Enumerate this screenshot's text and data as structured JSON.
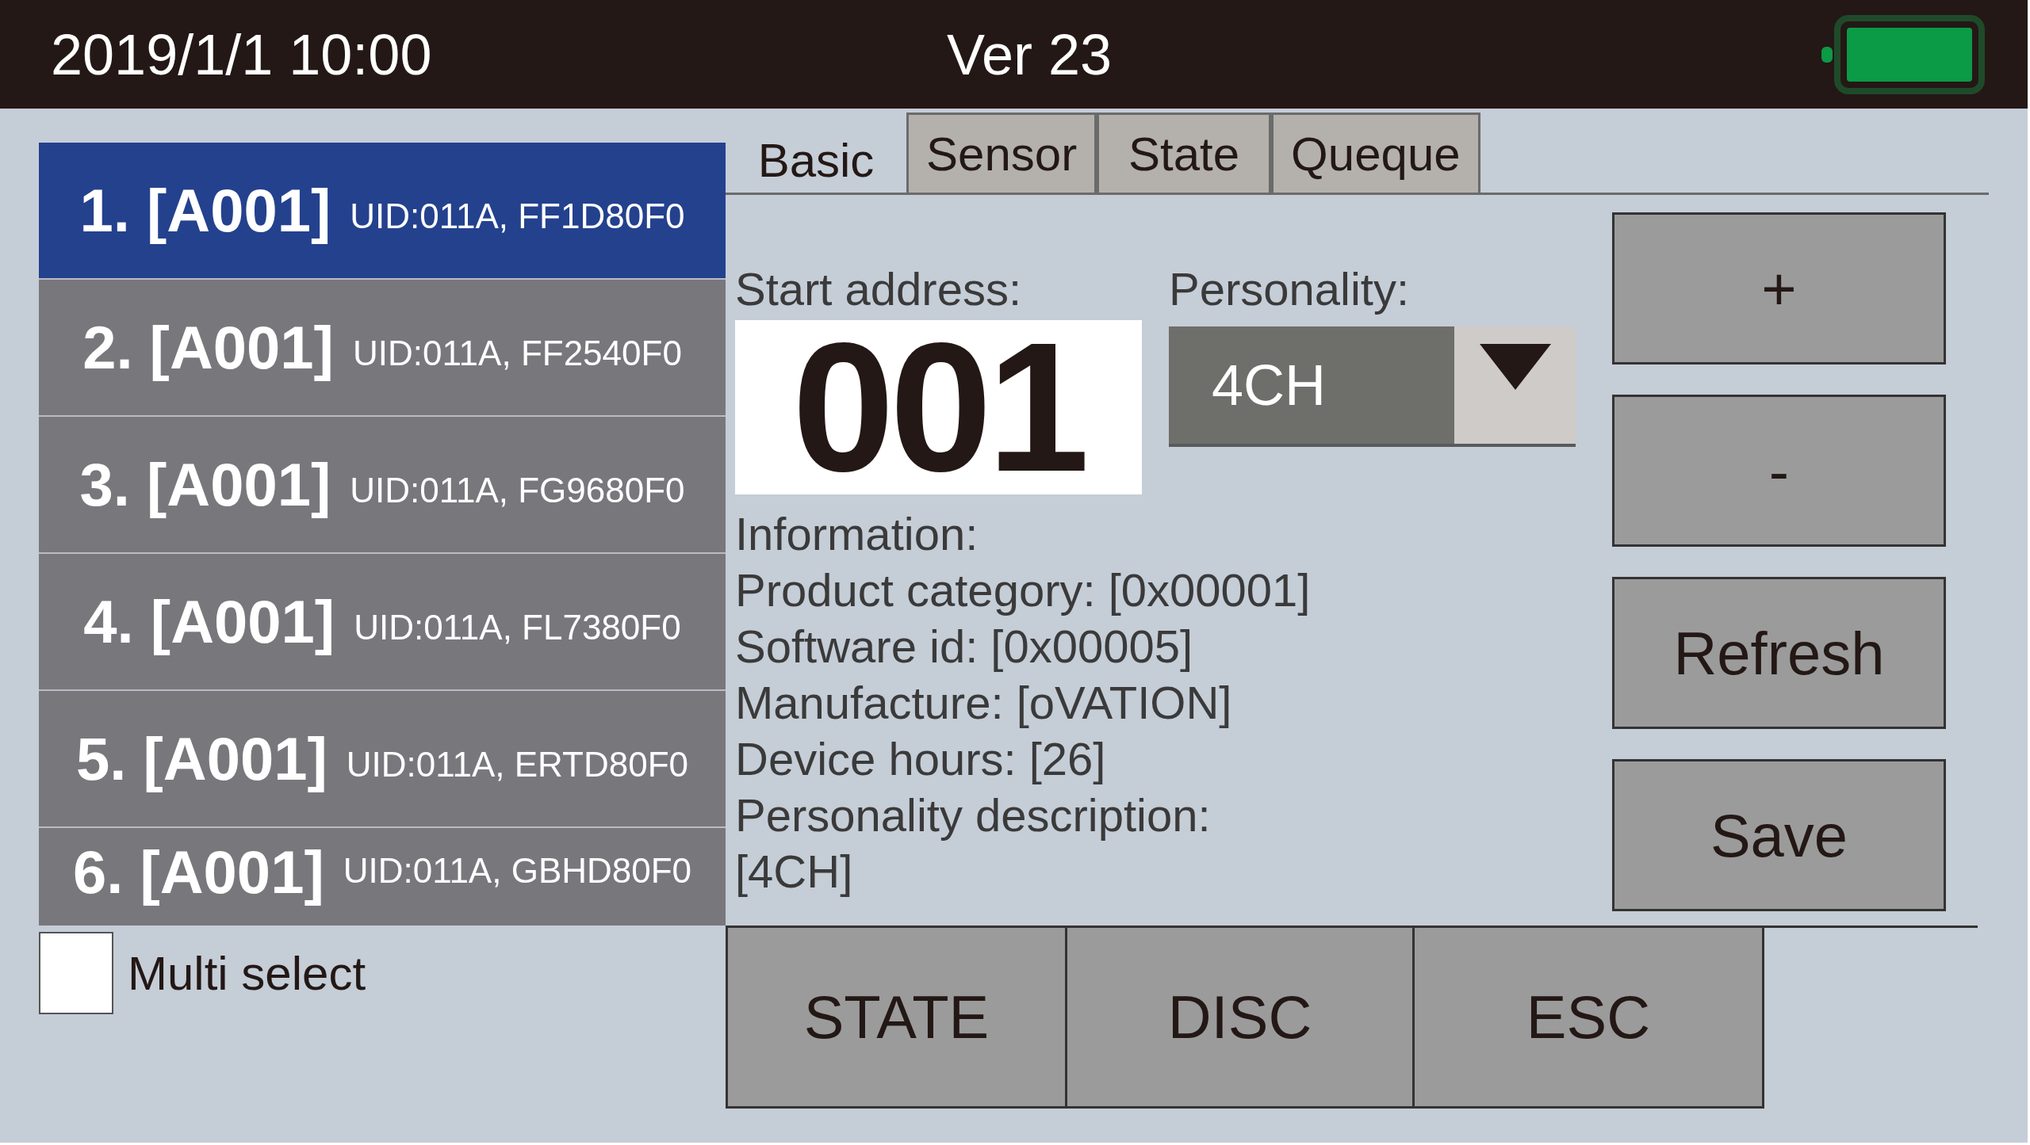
{
  "status_bar": {
    "datetime": "2019/1/1 10:00",
    "version": "Ver 23"
  },
  "devices": [
    {
      "label": "1. [A001]",
      "uid": "UID:011A, FF1D80F0",
      "selected": true
    },
    {
      "label": "2. [A001]",
      "uid": "UID:011A, FF2540F0",
      "selected": false
    },
    {
      "label": "3. [A001]",
      "uid": "UID:011A, FG9680F0",
      "selected": false
    },
    {
      "label": "4. [A001]",
      "uid": "UID:011A, FL7380F0",
      "selected": false
    },
    {
      "label": "5. [A001]",
      "uid": "UID:011A, ERTD80F0",
      "selected": false
    },
    {
      "label": "6. [A001]",
      "uid": "UID:011A, GBHD80F0",
      "selected": false
    }
  ],
  "multi_select": {
    "label": "Multi select",
    "checked": false
  },
  "tabs": [
    {
      "label": "Basic",
      "selected": true
    },
    {
      "label": "Sensor",
      "selected": false
    },
    {
      "label": "State",
      "selected": false
    },
    {
      "label": "Queque",
      "selected": false
    }
  ],
  "start_address": {
    "label": "Start address:",
    "value": "001"
  },
  "personality": {
    "label": "Personality:",
    "value": "4CH"
  },
  "information": [
    "Information:",
    "Product category: [0x00001]",
    "Software id: [0x00005]",
    "Manufacture: [oVATION]",
    "Device hours: [26]",
    "Personality description:",
    "[4CH]"
  ],
  "side_buttons": [
    "+",
    "-",
    "Refresh",
    "Save"
  ],
  "bottom_buttons": [
    "STATE",
    "DISC",
    "ESC"
  ]
}
